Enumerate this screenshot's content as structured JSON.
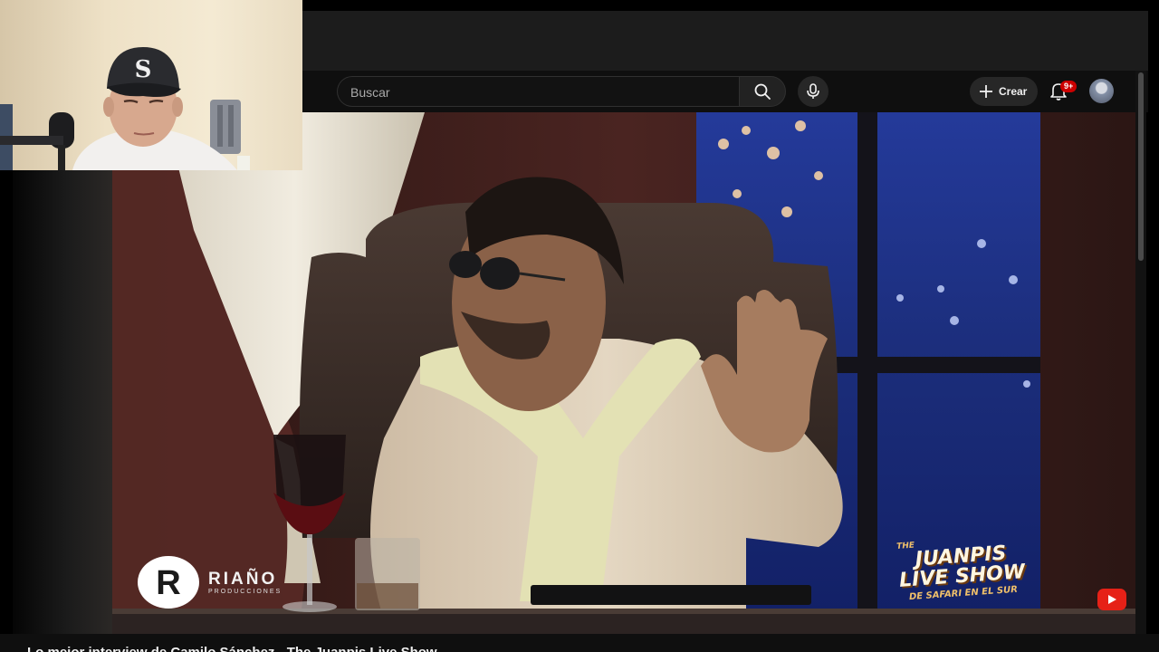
{
  "header": {
    "search": {
      "placeholder": "Buscar"
    },
    "search_icon": "search-icon",
    "mic_icon": "mic-icon",
    "create_label": "Crear",
    "notifications_badge": "9+",
    "avatar_icon": "avatar"
  },
  "video": {
    "watermark_brand": "RIAÑO",
    "watermark_sub": "PRODUCCIONES",
    "show_logo_lines": [
      "THE",
      "JUANPIS",
      "LIVE SHOW",
      "DE SAFARI EN EL SUR"
    ],
    "title": "Lo mejor interview de Camilo Sánchez - The Juanpis Live Show"
  },
  "colors": {
    "accent_red": "#cc0000",
    "background": "#0f0f0f",
    "youtube_red": "#e62117"
  }
}
